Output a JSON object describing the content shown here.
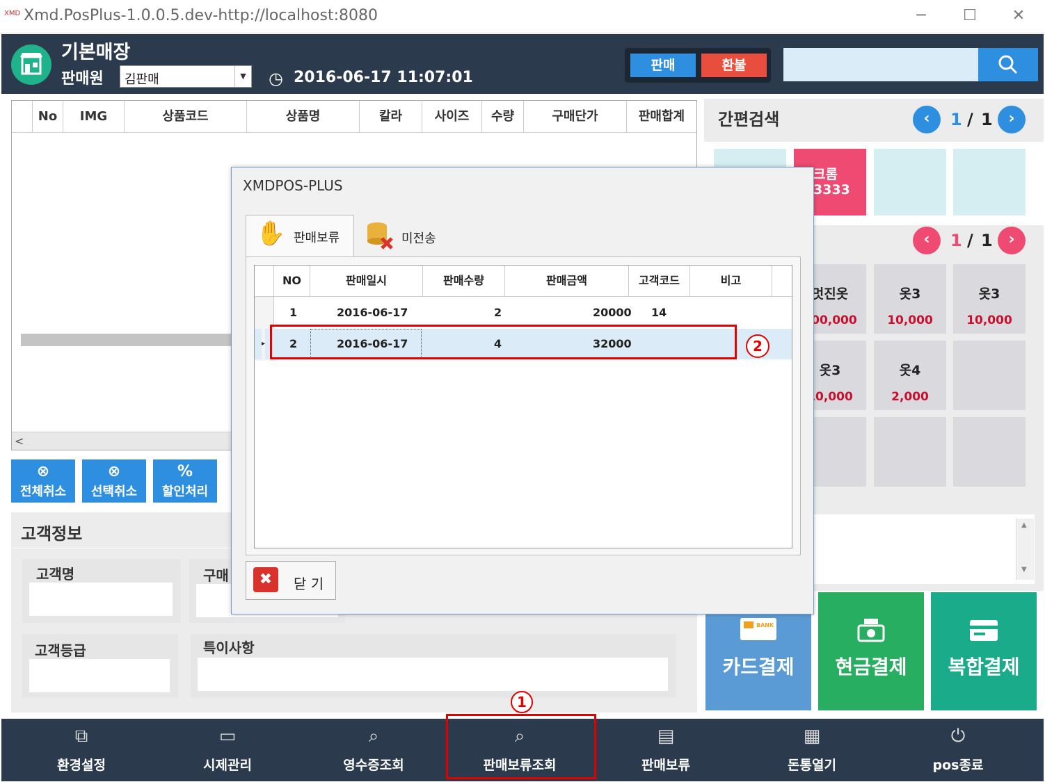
{
  "window": {
    "title": "Xmd.PosPlus-1.0.0.5.dev-http://localhost:8080",
    "minimize": "─",
    "maximize": "☐",
    "close": "✕"
  },
  "header": {
    "store_name": "기본매장",
    "seller_label": "판매원",
    "seller_value": "김판매",
    "datetime": "2016-06-17 11:07:01",
    "sale_btn": "판매",
    "refund_btn": "환불",
    "search_placeholder": ""
  },
  "main_grid": {
    "columns": [
      "No",
      "IMG",
      "상품코드",
      "상품명",
      "칼라",
      "사이즈",
      "수량",
      "구매단가",
      "판매합계"
    ]
  },
  "actions": {
    "cancel_all": "전체취소",
    "cancel_selected": "선택취소",
    "discount": "할인처리"
  },
  "customer": {
    "title": "고객정보",
    "name_label": "고객명",
    "purchase_label": "구매",
    "grade_label": "고객등급",
    "note_label": "특이사항"
  },
  "quick_search": {
    "title": "간편검색",
    "category_page": "1",
    "category_total": "1",
    "product_page": "1",
    "product_total": "1",
    "category_tiles": [
      {
        "text1": "",
        "text2": "",
        "color": "#d4eef2"
      },
      {
        "text1": "크롬",
        "text2": "3333",
        "color": "#ef4a72"
      },
      {
        "text1": "",
        "text2": "",
        "color": "#d4eef2"
      },
      {
        "text1": "",
        "text2": "",
        "color": "#d4eef2"
      }
    ],
    "products": [
      {
        "name": "멋진옷",
        "price": "100,000"
      },
      {
        "name": "옷3",
        "price": "10,000"
      },
      {
        "name": "옷3",
        "price": "10,000"
      },
      {
        "name": "옷3",
        "price": "10,000"
      },
      {
        "name": "옷4",
        "price": "2,000"
      },
      {
        "name": "",
        "price": ""
      },
      {
        "name": "",
        "price": ""
      },
      {
        "name": "",
        "price": ""
      },
      {
        "name": "",
        "price": ""
      }
    ]
  },
  "payment": {
    "card": "카드결제",
    "cash": "현금결제",
    "complex": "복합결제",
    "card_color": "#5b9bd5",
    "cash_color": "#27ae60",
    "complex_color": "#1aab8a"
  },
  "bottom": {
    "items": [
      {
        "label": "환경설정",
        "icon": "⧉"
      },
      {
        "label": "시제관리",
        "icon": "▭"
      },
      {
        "label": "영수증조회",
        "icon": "⌕"
      },
      {
        "label": "판매보류조회",
        "icon": "⌕"
      },
      {
        "label": "판매보류",
        "icon": "▤"
      },
      {
        "label": "돈통열기",
        "icon": "▦"
      },
      {
        "label": "pos종료",
        "icon": "⏻"
      }
    ]
  },
  "dialog": {
    "title": "XMDPOS-PLUS",
    "tab_hold": "판매보류",
    "tab_unsent": "미전송",
    "columns": [
      "NO",
      "판매일시",
      "판매수량",
      "판매금액",
      "고객코드",
      "비고"
    ],
    "rows": [
      {
        "no": "1",
        "date": "2016-06-17",
        "qty": "2",
        "amount": "20000",
        "cust": "14",
        "note": ""
      },
      {
        "no": "2",
        "date": "2016-06-17",
        "qty": "4",
        "amount": "32000",
        "cust": "",
        "note": ""
      }
    ],
    "close_label": "닫 기"
  },
  "annotations": {
    "marker1": "1",
    "marker2": "2",
    "color": "#e30000"
  }
}
